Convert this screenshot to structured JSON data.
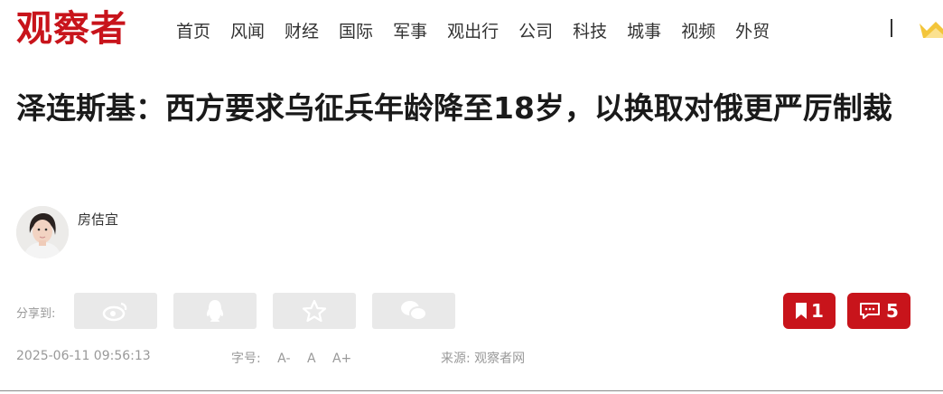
{
  "header": {
    "logo": "观察者",
    "nav": [
      "首页",
      "风闻",
      "财经",
      "国际",
      "军事",
      "观出行",
      "公司",
      "科技",
      "城事",
      "视频",
      "外贸"
    ],
    "separator": "|"
  },
  "article": {
    "title": "泽连斯基：西方要求乌征兵年龄降至18岁，以换取对俄更严厉制裁",
    "author": "房佶宜",
    "share_label": "分享到:",
    "share_icons": [
      "weibo-icon",
      "qq-icon",
      "qzone-star-icon",
      "wechat-icon"
    ],
    "bookmark_count": "1",
    "comment_count": "5",
    "date": "2025-06-11 09:56:13",
    "font_size_label": "字号:",
    "font_sizes": [
      "A-",
      "A",
      "A+"
    ],
    "source": "来源: 观察者网"
  },
  "colors": {
    "brand": "#c8141b",
    "share_bg": "#e9e9e9",
    "meta_text": "#999999"
  }
}
